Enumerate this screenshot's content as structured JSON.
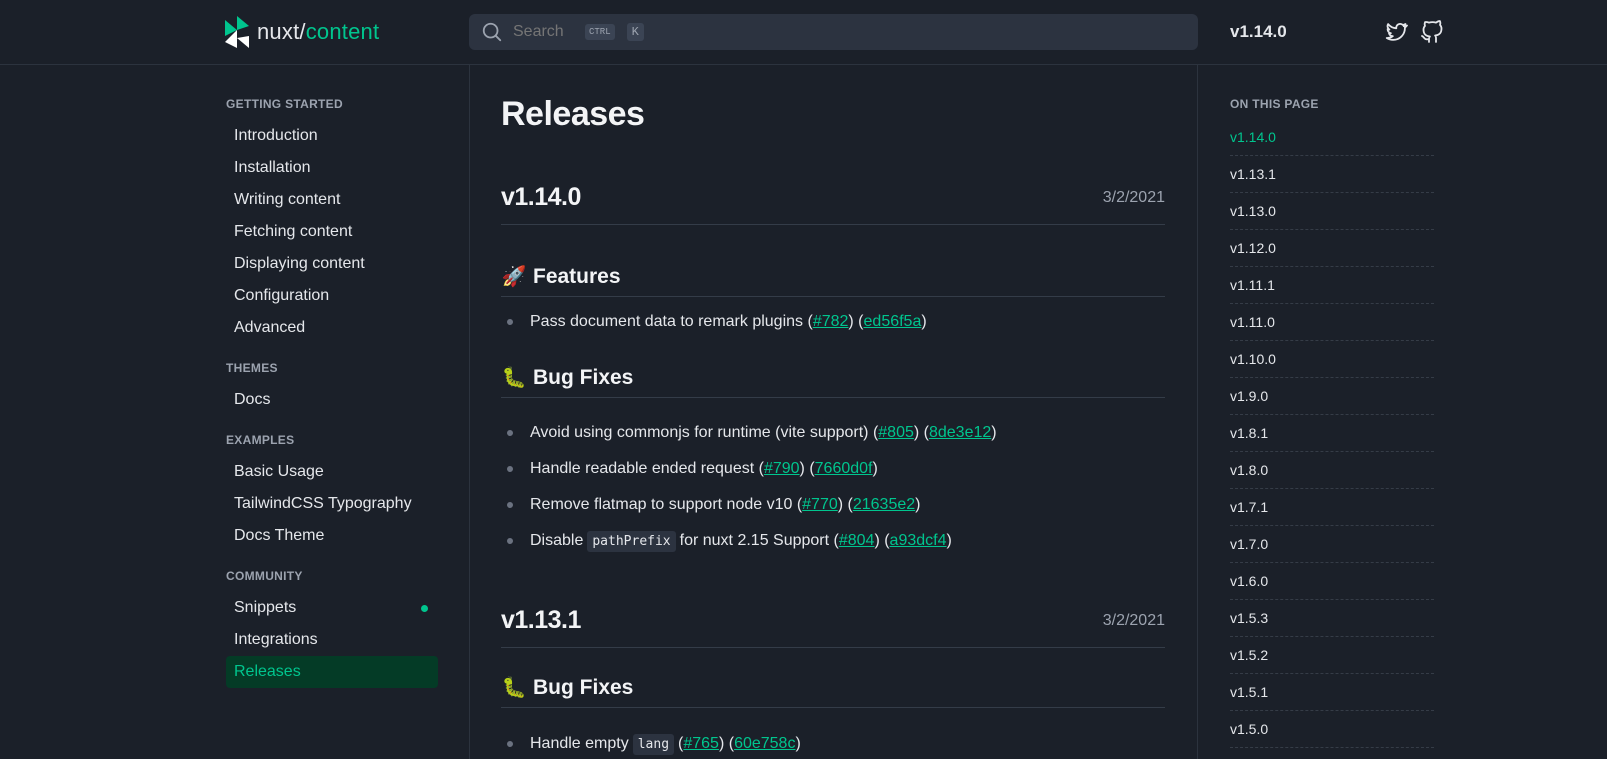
{
  "header": {
    "logo_part1": "nuxt/",
    "logo_part2": "content",
    "search_placeholder": "Search",
    "kbd_ctrl": "CTRL",
    "kbd_k": "K",
    "version": "v1.14.0"
  },
  "sidebar": {
    "sections": [
      {
        "title": "GETTING STARTED",
        "items": [
          "Introduction",
          "Installation",
          "Writing content",
          "Fetching content",
          "Displaying content",
          "Configuration",
          "Advanced"
        ]
      },
      {
        "title": "THEMES",
        "items": [
          "Docs"
        ]
      },
      {
        "title": "EXAMPLES",
        "items": [
          "Basic Usage",
          "TailwindCSS Typography",
          "Docs Theme"
        ]
      },
      {
        "title": "COMMUNITY",
        "items": [
          "Snippets",
          "Integrations",
          "Releases"
        ]
      }
    ]
  },
  "main": {
    "title": "Releases",
    "release1": {
      "version": "v1.14.0",
      "date": "3/2/2021",
      "features_title": "Features",
      "features_emoji": "🚀",
      "feature1": {
        "text": "Pass document data to remark plugins (",
        "pr": "#782",
        "mid": ") (",
        "commit": "ed56f5a",
        "end": ")"
      },
      "bugfix_title": "Bug Fixes",
      "bugfix_emoji": "🐛",
      "fix1": {
        "text": "Avoid using commonjs for runtime (vite support) (",
        "pr": "#805",
        "mid": ") (",
        "commit": "8de3e12",
        "end": ")"
      },
      "fix2": {
        "text": "Handle readable ended request (",
        "pr": "#790",
        "mid": ") (",
        "commit": "7660d0f",
        "end": ")"
      },
      "fix3": {
        "text": "Remove flatmap to support node v10 (",
        "pr": "#770",
        "mid": ") (",
        "commit": "21635e2",
        "end": ")"
      },
      "fix4": {
        "text": "Disable",
        "code": "pathPrefix",
        "text2": "for nuxt 2.15 Support (",
        "pr": "#804",
        "mid": ") (",
        "commit": "a93dcf4",
        "end": ")"
      }
    },
    "release2": {
      "version": "v1.13.1",
      "date": "3/2/2021",
      "bugfix_title": "Bug Fixes",
      "bugfix_emoji": "🐛",
      "fix1": {
        "text": "Handle empty",
        "code": "lang",
        "text2": "(",
        "pr": "#765",
        "mid": ") (",
        "commit": "60e758c",
        "end": ")"
      }
    }
  },
  "toc": {
    "title": "ON THIS PAGE",
    "items": [
      "v1.14.0",
      "v1.13.1",
      "v1.13.0",
      "v1.12.0",
      "v1.11.1",
      "v1.11.0",
      "v1.10.0",
      "v1.9.0",
      "v1.8.1",
      "v1.8.0",
      "v1.7.1",
      "v1.7.0",
      "v1.6.0",
      "v1.5.3",
      "v1.5.2",
      "v1.5.1",
      "v1.5.0"
    ]
  },
  "colors": {
    "accent": "#00c58e",
    "background": "#1b2029",
    "active_bg": "#043b26"
  }
}
